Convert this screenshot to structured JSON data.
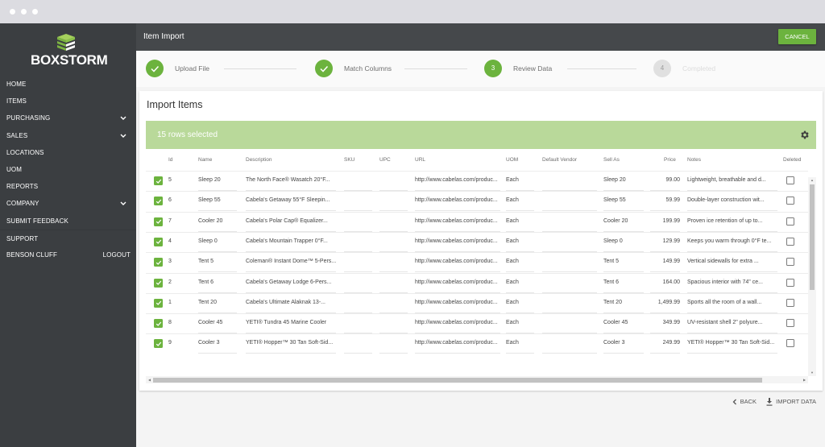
{
  "window": {
    "dots": 3
  },
  "brand": {
    "name": "BOXSTORM",
    "logo_icon": "stacked-boxes-icon",
    "accent": "#6cb33e"
  },
  "sidebar": {
    "items": [
      {
        "label": "HOME",
        "expandable": false
      },
      {
        "label": "ITEMS",
        "expandable": false
      },
      {
        "label": "PURCHASING",
        "expandable": true
      },
      {
        "label": "SALES",
        "expandable": true
      },
      {
        "label": "LOCATIONS",
        "expandable": false
      },
      {
        "label": "UOM",
        "expandable": false
      },
      {
        "label": "REPORTS",
        "expandable": false
      },
      {
        "label": "COMPANY",
        "expandable": true
      },
      {
        "label": "SUBMIT FEEDBACK",
        "expandable": false
      },
      {
        "label": "SUPPORT",
        "expandable": false
      }
    ],
    "user": {
      "name": "BENSON CLUFF",
      "logout_label": "LOGOUT"
    }
  },
  "header": {
    "title": "Item Import",
    "cancel_label": "CANCEL"
  },
  "stepper": {
    "steps": [
      {
        "number": "1",
        "label": "Upload File",
        "state": "done"
      },
      {
        "number": "2",
        "label": "Match Columns",
        "state": "done"
      },
      {
        "number": "3",
        "label": "Review Data",
        "state": "active"
      },
      {
        "number": "4",
        "label": "Completed",
        "state": "pending"
      }
    ]
  },
  "card": {
    "title": "Import Items",
    "selection_text": "15 rows selected",
    "settings_icon": "gear-icon"
  },
  "table": {
    "columns": [
      "Id",
      "Name",
      "Description",
      "SKU",
      "UPC",
      "URL",
      "UOM",
      "Default Vendor",
      "Sell As",
      "Price",
      "Notes",
      "Deleted"
    ],
    "rows": [
      {
        "selected": true,
        "id": "5",
        "name": "Sleep 20",
        "description": "The North Face® Wasatch 20°F...",
        "sku": "",
        "upc": "",
        "url": "http://www.cabelas.com/produc...",
        "uom": "Each",
        "vendor": "",
        "sell_as": "Sleep 20",
        "price": "99.00",
        "notes": "Lightweight, breathable and d...",
        "deleted": false
      },
      {
        "selected": true,
        "id": "6",
        "name": "Sleep 55",
        "description": "Cabela's Getaway 55°F Sleepin...",
        "sku": "",
        "upc": "",
        "url": "http://www.cabelas.com/produc...",
        "uom": "Each",
        "vendor": "",
        "sell_as": "Sleep 55",
        "price": "59.99",
        "notes": "Double-layer construction wit...",
        "deleted": false
      },
      {
        "selected": true,
        "id": "7",
        "name": "Cooler 20",
        "description": "Cabela's Polar Cap® Equalizer...",
        "sku": "",
        "upc": "",
        "url": "http://www.cabelas.com/produc...",
        "uom": "Each",
        "vendor": "",
        "sell_as": "Cooler 20",
        "price": "199.99",
        "notes": "Proven ice retention of up to...",
        "deleted": false
      },
      {
        "selected": true,
        "id": "4",
        "name": "Sleep 0",
        "description": "Cabela's Mountain Trapper 0°F...",
        "sku": "",
        "upc": "",
        "url": "http://www.cabelas.com/produc...",
        "uom": "Each",
        "vendor": "",
        "sell_as": "Sleep 0",
        "price": "129.99",
        "notes": "Keeps you warm through 0°F te...",
        "deleted": false
      },
      {
        "selected": true,
        "id": "3",
        "name": "Tent 5",
        "description": "Coleman® Instant Dome™ 5-Pers...",
        "sku": "",
        "upc": "",
        "url": "http://www.cabelas.com/produc...",
        "uom": "Each",
        "vendor": "",
        "sell_as": "Tent 5",
        "price": "149.99",
        "notes": "Vertical sidewalls for extra ...",
        "deleted": false
      },
      {
        "selected": true,
        "id": "2",
        "name": "Tent 6",
        "description": "Cabela's Getaway Lodge 6-Pers...",
        "sku": "",
        "upc": "",
        "url": "http://www.cabelas.com/produc...",
        "uom": "Each",
        "vendor": "",
        "sell_as": "Tent 6",
        "price": "164.00",
        "notes": "Spacious interior with 74\" ce...",
        "deleted": false
      },
      {
        "selected": true,
        "id": "1",
        "name": "Tent 20",
        "description": "Cabela's Ultimate Alaknak 13-...",
        "sku": "",
        "upc": "",
        "url": "http://www.cabelas.com/produc...",
        "uom": "Each",
        "vendor": "",
        "sell_as": "Tent 20",
        "price": "1,499.99",
        "notes": "Sports all the room of a wall...",
        "deleted": false
      },
      {
        "selected": true,
        "id": "8",
        "name": "Cooler 45",
        "description": "YETI® Tundra 45 Marine Cooler",
        "sku": "",
        "upc": "",
        "url": "http://www.cabelas.com/produc...",
        "uom": "Each",
        "vendor": "",
        "sell_as": "Cooler 45",
        "price": "349.99",
        "notes": "UV-resistant shell 2\" polyure...",
        "deleted": false
      },
      {
        "selected": true,
        "id": "9",
        "name": "Cooler 3",
        "description": "YETI® Hopper™ 30 Tan Soft-Sid...",
        "sku": "",
        "upc": "",
        "url": "http://www.cabelas.com/produc...",
        "uom": "Each",
        "vendor": "",
        "sell_as": "Cooler 3",
        "price": "249.99",
        "notes": "YETI® Hopper™ 30 Tan Soft-Sid...",
        "deleted": false
      }
    ]
  },
  "actions": {
    "back_label": "BACK",
    "import_label": "IMPORT DATA"
  }
}
